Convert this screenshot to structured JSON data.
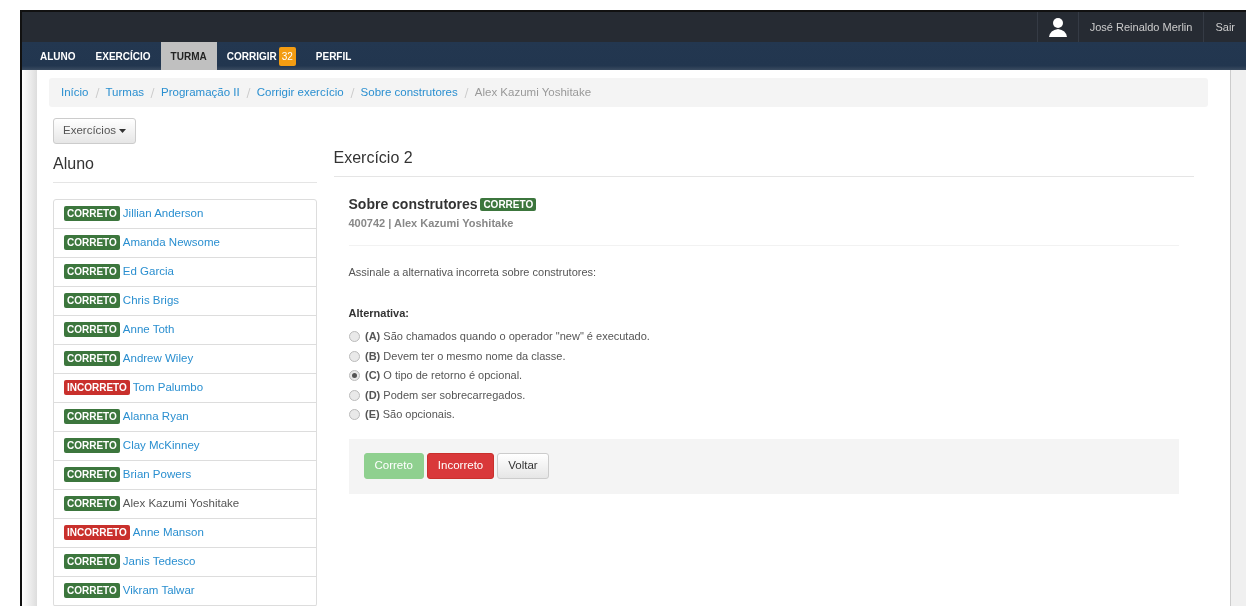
{
  "user": {
    "name": "José Reinaldo Merlin",
    "logout": "Sair"
  },
  "nav": [
    {
      "label": "ALUNO",
      "selected": false
    },
    {
      "label": "EXERCÍCIO",
      "selected": false
    },
    {
      "label": "TURMA",
      "selected": true
    },
    {
      "label": "CORRIGIR",
      "selected": false,
      "badge": "32"
    },
    {
      "label": "PERFIL",
      "selected": false
    }
  ],
  "breadcrumb": [
    {
      "label": "Início",
      "link": true
    },
    {
      "label": "Turmas",
      "link": true
    },
    {
      "label": "Programação II",
      "link": true
    },
    {
      "label": "Corrigir exercício",
      "link": true
    },
    {
      "label": "Sobre construtores",
      "link": true
    },
    {
      "label": "Alex Kazumi Yoshitake",
      "link": false
    }
  ],
  "dropdown": "Exercícios",
  "students_heading": "Aluno",
  "students": [
    {
      "color": "#3c763d",
      "badge": "CORRETO",
      "name": "Jillian Anderson",
      "selected": false
    },
    {
      "color": "#3c763d",
      "badge": "CORRETO",
      "name": "Amanda Newsome",
      "selected": false
    },
    {
      "color": "#3c763d",
      "badge": "CORRETO",
      "name": "Ed Garcia",
      "selected": false
    },
    {
      "color": "#3c763d",
      "badge": "CORRETO",
      "name": "Chris Brigs",
      "selected": false
    },
    {
      "color": "#3c763d",
      "badge": "CORRETO",
      "name": "Anne Toth",
      "selected": false
    },
    {
      "color": "#3c763d",
      "badge": "CORRETO",
      "name": "Andrew Wiley",
      "selected": false
    },
    {
      "color": "#c9302c",
      "badge": "INCORRETO",
      "name": "Tom Palumbo",
      "selected": false
    },
    {
      "color": "#3c763d",
      "badge": "CORRETO",
      "name": "Alanna Ryan",
      "selected": false
    },
    {
      "color": "#3c763d",
      "badge": "CORRETO",
      "name": "Clay McKinney",
      "selected": false
    },
    {
      "color": "#3c763d",
      "badge": "CORRETO",
      "name": "Brian Powers",
      "selected": false
    },
    {
      "color": "#3c763d",
      "badge": "CORRETO",
      "name": "Alex Kazumi Yoshitake",
      "selected": true
    },
    {
      "color": "#c9302c",
      "badge": "INCORRETO",
      "name": "Anne Manson",
      "selected": false
    },
    {
      "color": "#3c763d",
      "badge": "CORRETO",
      "name": "Janis Tedesco",
      "selected": false
    },
    {
      "color": "#3c763d",
      "badge": "CORRETO",
      "name": "Vikram Talwar",
      "selected": false
    }
  ],
  "exercise_heading": "Exercício 2",
  "exercise": {
    "title": "Sobre construtores",
    "color": "#3c763d",
    "badge": "CORRETO",
    "subtitle": "400742 | Alex Kazumi Yoshitake",
    "question": "Assinale a alternativa incorreta sobre construtores:",
    "options_label": "Alternativa:",
    "options": [
      {
        "text": "**(A)** São chamados quando o operador \"new\" é executado.",
        "selected": false
      },
      {
        "text": "**(B)** Devem ter o mesmo nome da classe.",
        "selected": false
      },
      {
        "text": "**(C)** O tipo de retorno é opcional.",
        "selected": true
      },
      {
        "text": "**(D)** Podem ser sobrecarregados.",
        "selected": false
      },
      {
        "text": "**(E)** São opcionais.",
        "selected": false
      }
    ]
  },
  "actions": [
    {
      "kind": "correct",
      "label": "Correto",
      "disabled": true
    },
    {
      "kind": "incorrect",
      "label": "Incorreto",
      "disabled": false
    },
    {
      "kind": "back",
      "label": "Voltar",
      "disabled": false
    }
  ]
}
